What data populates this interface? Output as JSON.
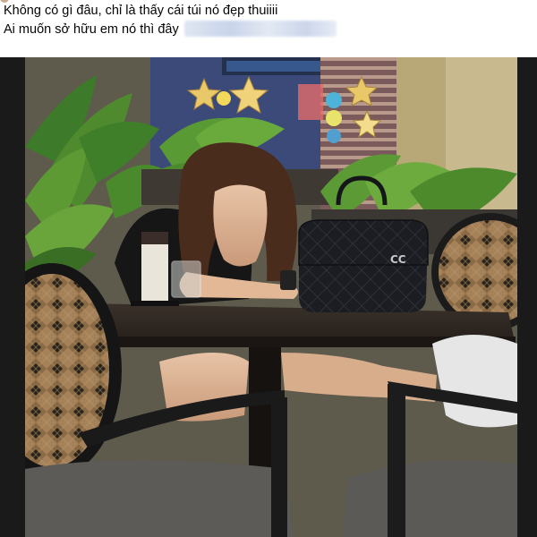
{
  "post": {
    "line1": "Không có gì đâu, chỉ là thấy cái túi nó đẹp thuiiii",
    "line2": "Ai muốn sở hữu em nó thì đây"
  },
  "photo": {
    "bag_logo": "CC",
    "colors": {
      "table": "#2c2520",
      "bag": "#1b1c20",
      "shirt": "#1a1a1a",
      "plants": "#4f8a2e",
      "wall": "#b7a98a",
      "chair_rattan": "#9c7a55",
      "chair_frame": "#1b1b1b",
      "chair_cushion": "#5c5b58"
    }
  }
}
